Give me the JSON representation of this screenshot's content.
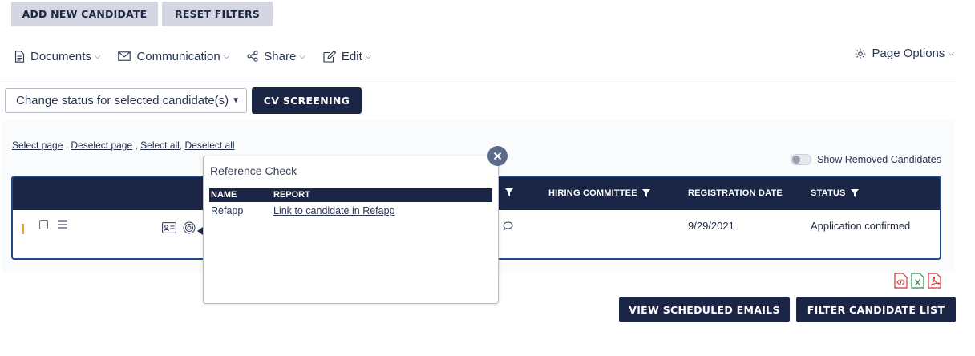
{
  "top_buttons": {
    "add_candidate": "ADD NEW CANDIDATE",
    "reset_filters": "RESET FILTERS"
  },
  "toolbar": {
    "documents": "Documents",
    "communication": "Communication",
    "share": "Share",
    "edit": "Edit",
    "page_options": "Page Options"
  },
  "status_select": {
    "value": "Change status for selected candidate(s)"
  },
  "cv_screening_button": "CV SCREENING",
  "selection_links": {
    "select_page": "Select page",
    "deselect_page": "Deselect page",
    "select_all": "Select all",
    "deselect_all": "Deselect all"
  },
  "show_removed": {
    "label": "Show Removed Candidates",
    "checked": false
  },
  "table": {
    "columns": {
      "hiring_committee": "HIRING COMMITTEE",
      "registration_date": "REGISTRATION DATE",
      "status": "STATUS"
    },
    "rows": [
      {
        "registration_date": "9/29/2021",
        "status": "Application confirmed"
      }
    ]
  },
  "reference_popup": {
    "title": "Reference Check",
    "columns": {
      "name": "NAME",
      "report": "REPORT"
    },
    "rows": [
      {
        "name": "Refapp",
        "report": "Link to candidate in Refapp"
      }
    ]
  },
  "bottom_buttons": {
    "view_scheduled_emails": "VIEW SCHEDULED EMAILS",
    "filter_candidate_list": "FILTER CANDIDATE LIST"
  },
  "icons": {
    "documents": "document-icon",
    "communication": "envelope-icon",
    "share": "share-icon",
    "edit": "edit-icon",
    "page_options": "gear-icon",
    "close": "close-icon",
    "export_xml": "xml-file-icon",
    "export_excel": "excel-file-icon",
    "export_pdf": "pdf-file-icon"
  },
  "colors": {
    "navy": "#1b2545",
    "light_button": "#d4d7e1",
    "table_border": "#1f4a8c",
    "row_marker": "#f2a01e",
    "close_button": "#5c6b87",
    "excel_green": "#2e8b57",
    "pdf_red": "#d9302c"
  }
}
